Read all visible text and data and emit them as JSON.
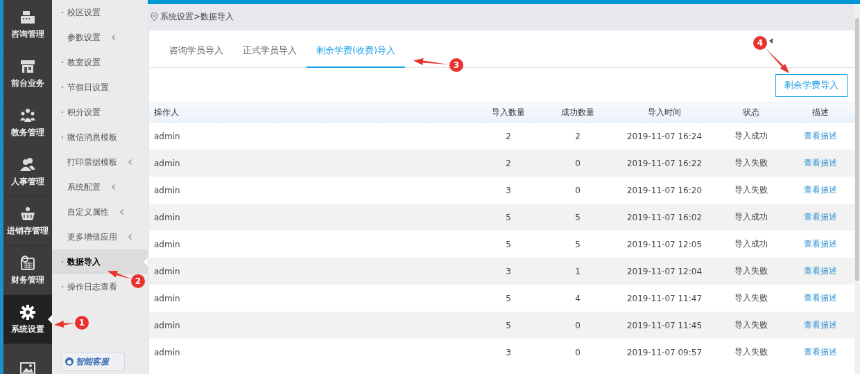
{
  "nav": {
    "items": [
      {
        "label": "咨询管理",
        "selected": false
      },
      {
        "label": "前台业务",
        "selected": false
      },
      {
        "label": "教务管理",
        "selected": false
      },
      {
        "label": "人事管理",
        "selected": false
      },
      {
        "label": "进销存管理",
        "selected": false
      },
      {
        "label": "财务管理",
        "selected": false
      },
      {
        "label": "系统设置",
        "selected": true
      },
      {
        "selected": false
      }
    ]
  },
  "submenu": {
    "items": [
      {
        "label": "校区设置",
        "expandable": false,
        "selected": false
      },
      {
        "label": "参数设置",
        "expandable": true,
        "selected": false
      },
      {
        "label": "教室设置",
        "expandable": false,
        "selected": false
      },
      {
        "label": "节假日设置",
        "expandable": false,
        "selected": false
      },
      {
        "label": "积分设置",
        "expandable": false,
        "selected": false
      },
      {
        "label": "微信消息模板",
        "expandable": false,
        "selected": false
      },
      {
        "label": "打印票据模板",
        "expandable": true,
        "selected": false
      },
      {
        "label": "系统配置",
        "expandable": true,
        "selected": false
      },
      {
        "label": "自定义属性",
        "expandable": true,
        "selected": false
      },
      {
        "label": "更多增值应用",
        "expandable": true,
        "selected": false
      },
      {
        "label": "数据导入",
        "expandable": false,
        "selected": true
      },
      {
        "label": "操作日志查看",
        "expandable": false,
        "selected": false
      }
    ],
    "support_button": "智能客服"
  },
  "breadcrumb": "系统设置>数据导入",
  "tabs": [
    {
      "label": "咨询学员导入",
      "selected": false
    },
    {
      "label": "正式学员导入",
      "selected": false
    },
    {
      "label": "剩余学费(收费)导入",
      "selected": true
    }
  ],
  "import_button": "剩余学费导入",
  "table": {
    "columns": [
      "操作人",
      "导入数量",
      "成功数量",
      "导入时间",
      "状态",
      "描述"
    ],
    "rows": [
      [
        "admin",
        "2",
        "2",
        "2019-11-07 16:24",
        "导入成功",
        "查看描述"
      ],
      [
        "admin",
        "2",
        "0",
        "2019-11-07 16:22",
        "导入失败",
        "查看描述"
      ],
      [
        "admin",
        "3",
        "0",
        "2019-11-07 16:20",
        "导入失败",
        "查看描述"
      ],
      [
        "admin",
        "5",
        "5",
        "2019-11-07 16:02",
        "导入成功",
        "查看描述"
      ],
      [
        "admin",
        "5",
        "5",
        "2019-11-07 12:05",
        "导入成功",
        "查看描述"
      ],
      [
        "admin",
        "3",
        "1",
        "2019-11-07 12:04",
        "导入失败",
        "查看描述"
      ],
      [
        "admin",
        "5",
        "4",
        "2019-11-07 11:47",
        "导入失败",
        "查看描述"
      ],
      [
        "admin",
        "5",
        "0",
        "2019-11-07 11:45",
        "导入失败",
        "查看描述"
      ],
      [
        "admin",
        "3",
        "0",
        "2019-11-07 09:57",
        "导入失败",
        "查看描述"
      ]
    ]
  },
  "annotations": [
    "1",
    "2",
    "3",
    "4"
  ]
}
